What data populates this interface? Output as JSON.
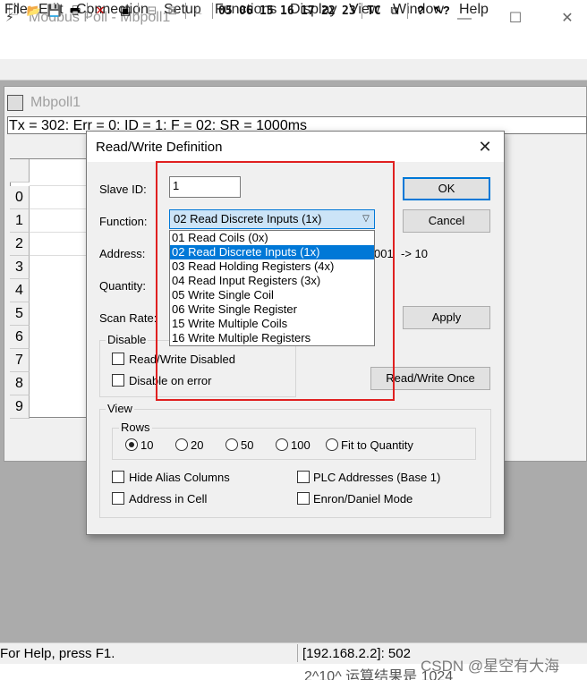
{
  "window": {
    "title": "Modbus Poll - Mbpoll1",
    "icon": "network-icon"
  },
  "menu": [
    "File",
    "Edit",
    "Connection",
    "Setup",
    "Functions",
    "Display",
    "View",
    "Window",
    "Help"
  ],
  "toolbar": {
    "codes": [
      "05",
      "06",
      "15",
      "16",
      "17",
      "22",
      "23"
    ],
    "tc": "TC",
    "icons": [
      "new-icon",
      "open-icon",
      "save-icon",
      "print-icon",
      "delete-icon",
      "window-icon",
      "connect-icon",
      "disconnect-icon",
      "pulse-icon",
      "help-icon",
      "context-help-icon"
    ]
  },
  "child": {
    "title": "Mbpoll1",
    "status": "Tx = 302: Err = 0: ID = 1: F = 02: SR = 1000ms",
    "rows": [
      "0",
      "1",
      "2",
      "3",
      "4",
      "5",
      "6",
      "7",
      "8",
      "9"
    ]
  },
  "dialog": {
    "title": "Read/Write Definition",
    "slave_id_label": "Slave ID:",
    "slave_id_value": "1",
    "function_label": "Function:",
    "function_value": "02 Read Discrete Inputs (1x)",
    "address_label": "Address:",
    "address_hint_a": "001",
    "address_hint_b": "-> 10",
    "quantity_label": "Quantity:",
    "scan_rate_label": "Scan Rate:",
    "buttons": {
      "ok": "OK",
      "cancel": "Cancel",
      "apply": "Apply",
      "rw_once": "Read/Write Once"
    },
    "function_options": [
      "01 Read Coils (0x)",
      "02 Read Discrete Inputs (1x)",
      "03 Read Holding Registers (4x)",
      "04 Read Input Registers (3x)",
      "05 Write Single Coil",
      "06 Write Single Register",
      "15 Write Multiple Coils",
      "16 Write Multiple Registers"
    ],
    "disable": {
      "title": "Disable",
      "rw_disabled": "Read/Write Disabled",
      "on_error": "Disable on error"
    },
    "view": {
      "title": "View",
      "rows_title": "Rows",
      "rows_options": [
        "10",
        "20",
        "50",
        "100",
        "Fit to Quantity"
      ],
      "rows_selected": "10",
      "hide_alias": "Hide Alias Columns",
      "plc_addresses": "PLC Addresses (Base 1)",
      "address_in_cell": "Address in Cell",
      "enron_mode": "Enron/Daniel Mode"
    }
  },
  "statusbar": {
    "help": "For Help, press F1.",
    "address": "[192.168.2.2]: 502"
  },
  "overlay": {
    "under_text": "2^10^ 运算结果是 1024",
    "watermark": "CSDN @星空有大海"
  },
  "colors": {
    "selection": "#0078d7",
    "highlight_box": "#e02020"
  }
}
